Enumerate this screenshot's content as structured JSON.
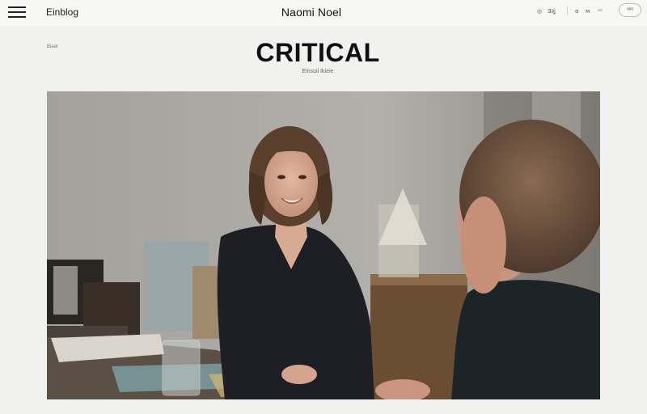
{
  "header": {
    "section_link": "Einblog",
    "site_title": "Naomi Noel",
    "utility_items": [
      "◎",
      "Ǝ∂ʝ",
      "ɞ",
      "ᴍ",
      "ᵒᵒ"
    ],
    "more_label": "ᵒᵒᵒ"
  },
  "article": {
    "kicker": "Biǝǝt",
    "headline": "CRITICAL",
    "byline": "Einsoil Ikieie"
  },
  "photo": {
    "description_icon": "photo-image"
  },
  "colors": {
    "background": "#f1f1ef",
    "topbar": "#f6f6f4",
    "text": "#1c1c1c"
  }
}
